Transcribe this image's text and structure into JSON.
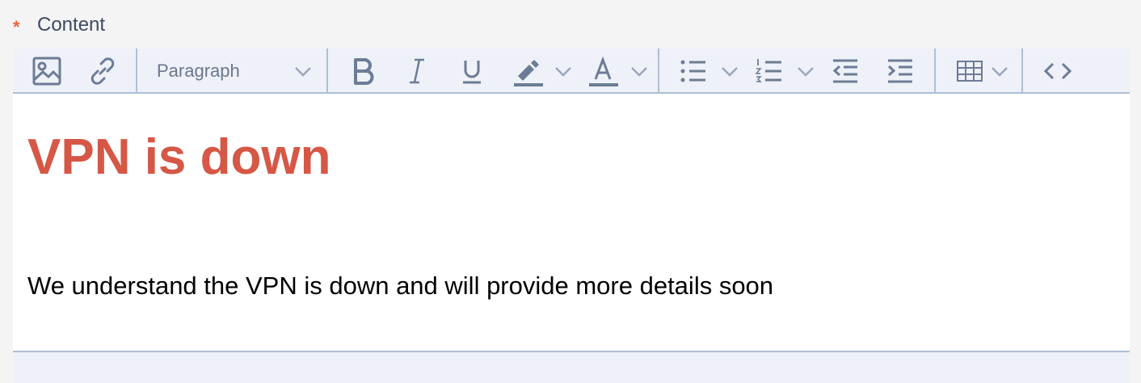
{
  "field": {
    "required_marker": "*",
    "label": "Content"
  },
  "toolbar": {
    "paragraph_select_value": "Paragraph",
    "icons": [
      "image-icon",
      "link-icon",
      "bold-icon",
      "italic-icon",
      "underline-icon",
      "highlight-icon",
      "font-color-icon",
      "bulleted-list-icon",
      "numbered-list-icon",
      "outdent-icon",
      "indent-icon",
      "table-icon",
      "source-code-icon"
    ]
  },
  "content": {
    "heading": "VPN is down",
    "paragraph": "We understand the VPN is down and will provide more details soon"
  },
  "colors": {
    "heading": "#d65745",
    "required_marker": "#e8683f",
    "icon": "#6c7c96",
    "toolbar_bg": "#eef1f7",
    "border": "#aebfd4"
  }
}
